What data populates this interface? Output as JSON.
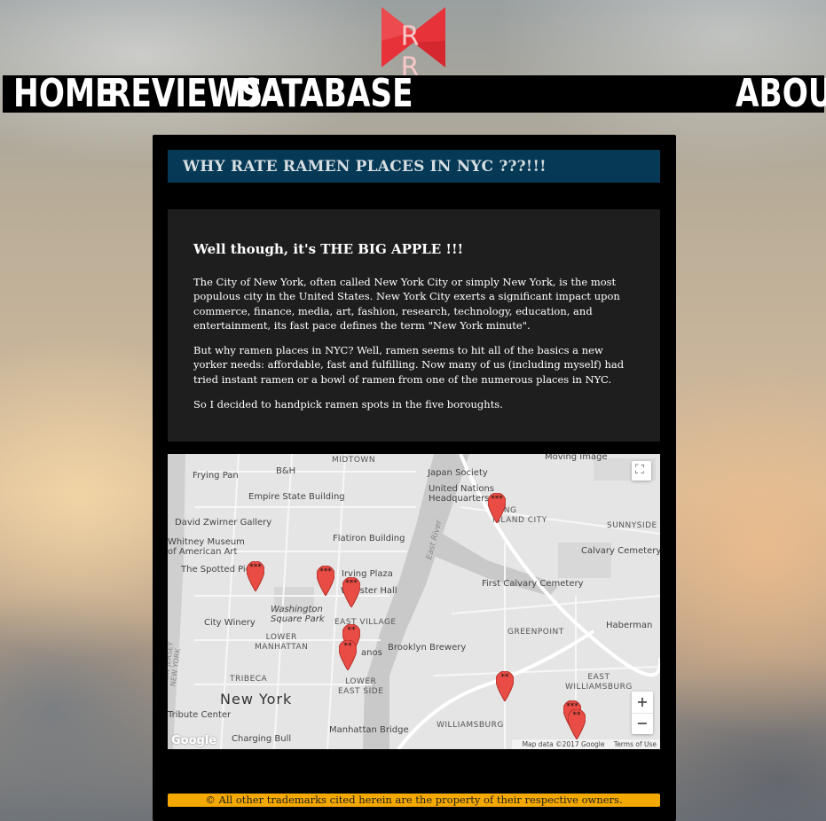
{
  "logo": {
    "letters": "R R",
    "colors": {
      "red": "#e8323a"
    }
  },
  "nav": {
    "home": "HOME",
    "reviews": "REVIEWS",
    "database": "DATABASE",
    "about": "ABOUT"
  },
  "section_title": "WHY RATE RAMEN PLACES IN NYC ???!!!",
  "article": {
    "heading": "Well though, it's THE BIG APPLE !!!",
    "p1": "The City of New York, often called New York City or simply New York, is the most populous city in the United States. New York City exerts a significant impact upon commerce, finance, media, art, fashion, research, technology, education, and entertainment, its fast pace defines the term \"New York minute\".",
    "p2": "But why ramen places in NYC? Well, ramen seems to hit all of the basics a new yorker needs: affordable, fast and fulfilling. Now many of us (including myself) had tried instant ramen or a bowl of ramen from one of the numerous places in NYC.",
    "p3": "So I decided to handpick ramen spots in the five boroughts."
  },
  "map": {
    "labels": {
      "midtown": "MIDTOWN",
      "moving_image": "Moving Image",
      "bh": "B&H",
      "japan_society": "Japan Society",
      "frying_pan": "Frying Pan",
      "un_hq": "United Nations\nHeadquarters",
      "empire": "Empire State Building",
      "long_island_city": "LONG\nISLAND CITY",
      "sunnyside": "SUNNYSIDE",
      "zwirner": "David Zwirner Gallery",
      "whitney": "Whitney Museum\nof American Art",
      "flatiron": "Flatiron Building",
      "calvary": "Calvary Cemetery",
      "spotted_pig": "The Spotted Pig",
      "irving": "Irving Plaza",
      "webster": "Webster Hall",
      "first_calvary": "First Calvary Cemetery",
      "washington": "Washington\nSquare Park",
      "east_village": "EAST VILLAGE",
      "city_winery": "City Winery",
      "lower_manhattan": "LOWER\nMANHATTAN",
      "greenpoint": "GREENPOINT",
      "haberman": "Haberman",
      "brooklyn_brewery": "Brooklyn Brewery",
      "tribeca": "TRIBECA",
      "lower_east_side": "LOWER\nEAST SIDE",
      "east_williamsburg": "EAST\nWILLIAMSBURG",
      "new_york": "New York",
      "tribute": "Tribute Center",
      "charging_bull": "Charging Bull",
      "manhattan_bridge": "Manhattan Bridge",
      "williamsburg": "WILLIAMSBURG",
      "east_river": "East River",
      "nj_label": "NEW JERSEY\nNEW YORK",
      "anos": "anos"
    },
    "pins": [
      {
        "stars": "***"
      },
      {
        "stars": "***"
      },
      {
        "stars": "***"
      },
      {
        "stars": "***"
      },
      {
        "stars": "**"
      },
      {
        "stars": "**"
      },
      {
        "stars": "**"
      },
      {
        "stars": "***"
      },
      {
        "stars": "**"
      }
    ],
    "google": "Google",
    "attribution": "Map data ©2017 Google",
    "terms": "Terms of Use",
    "zoom_in": "+",
    "zoom_out": "−",
    "fullscreen": "⛶"
  },
  "footer": "© All other trademarks cited herein are the property of their respective owners.",
  "colors": {
    "nav_bg": "#000000",
    "title_bar": "#053955",
    "card": "#1e1e1e",
    "footer": "#f4a802",
    "pin": "#e84c44"
  }
}
